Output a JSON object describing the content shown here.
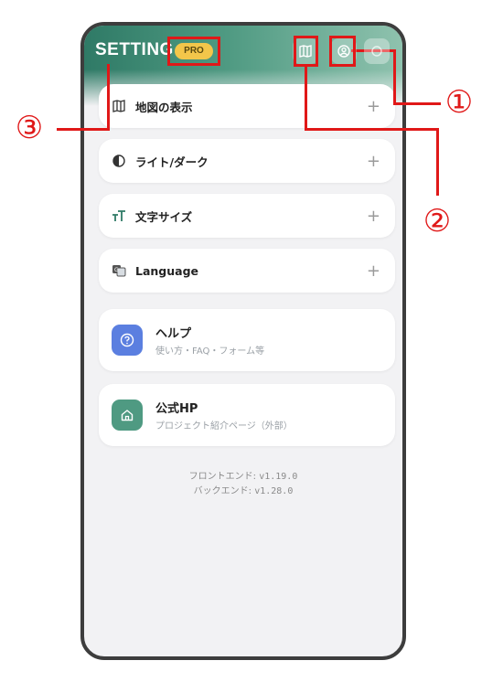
{
  "header": {
    "title": "SETTING",
    "pro_badge": "PRO"
  },
  "menu": [
    {
      "label": "地図の表示",
      "icon": "map-icon"
    },
    {
      "label": "ライト/ダーク",
      "icon": "contrast-icon"
    },
    {
      "label": "文字サイズ",
      "icon": "text-size-icon"
    },
    {
      "label": "Language",
      "icon": "translate-icon"
    }
  ],
  "plus": "+",
  "help": {
    "title": "ヘルプ",
    "subtitle": "使い方・FAQ・フォーム等",
    "icon": "question-icon",
    "color": "#5b7fe0"
  },
  "official": {
    "title": "公式HP",
    "subtitle": "プロジェクト紹介ページ（外部）",
    "icon": "home-icon",
    "color": "#4f9a82"
  },
  "versions": {
    "frontend_label": "フロントエンド:",
    "frontend_value": "v1.19.0",
    "backend_label": "バックエンド:",
    "backend_value": "v1.28.0"
  },
  "callouts": {
    "c1": "①",
    "c2": "②",
    "c3": "③"
  },
  "colors": {
    "accent": "#2f7a66",
    "pro": "#f3c64a",
    "annotation": "#e01818"
  }
}
